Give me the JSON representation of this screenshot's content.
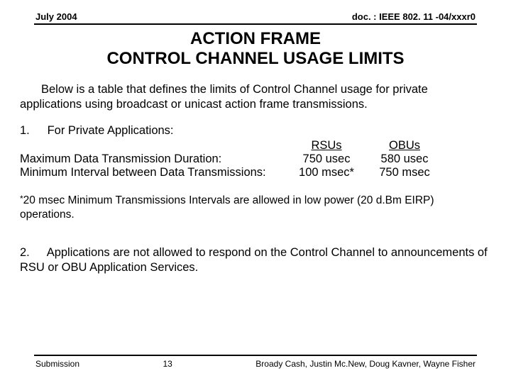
{
  "header": {
    "left": "July 2004",
    "right": "doc. : IEEE 802. 11 -04/xxxr0"
  },
  "title_line1": "ACTION FRAME",
  "title_line2": "CONTROL CHANNEL USAGE LIMITS",
  "intro": "Below is a table that defines the limits of Control Channel usage for private applications using broadcast or unicast action frame transmissions.",
  "section1": {
    "num": "1.",
    "label": "For Private Applications:",
    "col1": "RSUs",
    "col2": "OBUs",
    "rows": [
      {
        "label": "Maximum Data Transmission Duration:",
        "c1": "750 usec",
        "c2": "580 usec"
      },
      {
        "label": "Minimum Interval between Data Transmissions:",
        "c1": "100 msec*",
        "c2": "750 msec"
      }
    ]
  },
  "note_star": "*",
  "note": "20 msec Minimum Transmissions Intervals are allowed in low power (20 d.Bm EIRP) operations.",
  "section2": {
    "num": "2.",
    "text": "Applications are not allowed to respond on the Control Channel to announcements of RSU or OBU Application Services."
  },
  "footer": {
    "left": "Submission",
    "center": "13",
    "right": "Broady Cash, Justin Mc.New, Doug Kavner, Wayne Fisher"
  }
}
